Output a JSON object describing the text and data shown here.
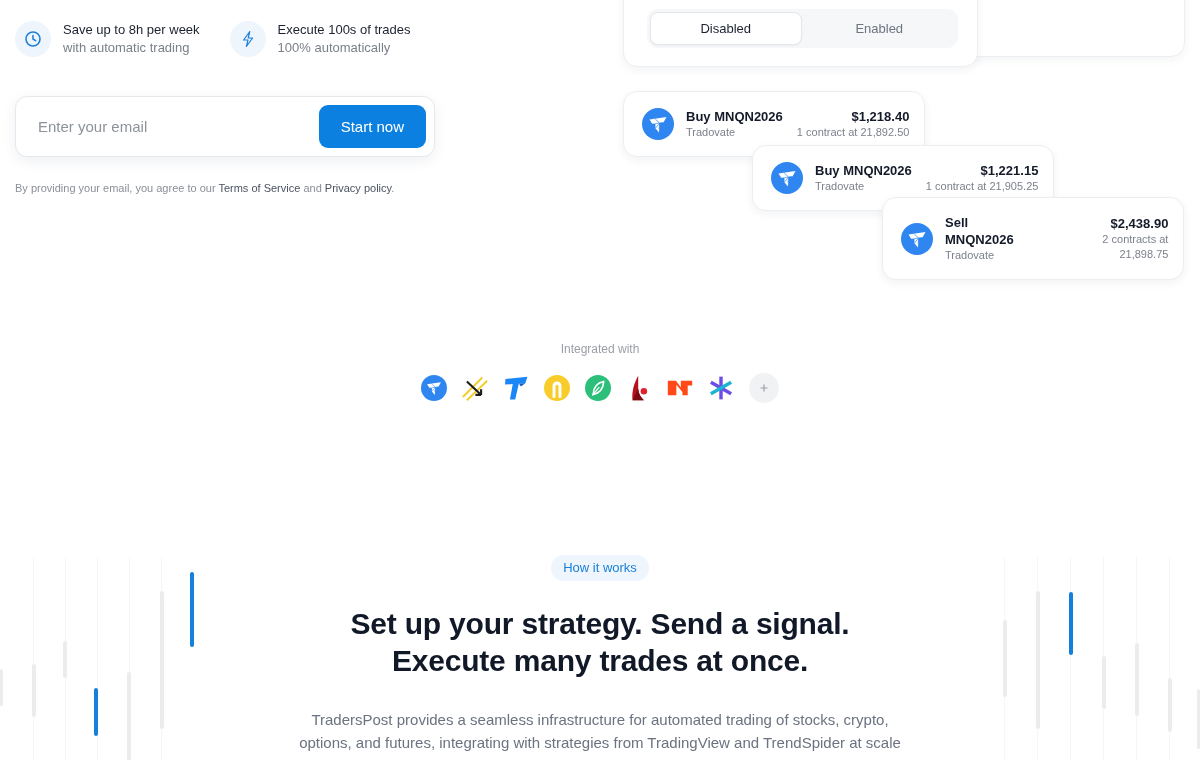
{
  "features": [
    {
      "title": "Save up to 8h per week",
      "subtitle": "with automatic trading"
    },
    {
      "title": "Execute 100s of trades",
      "subtitle": "100% automatically"
    }
  ],
  "signup_form": {
    "placeholder": "Enter your email",
    "button": "Start now"
  },
  "consent": {
    "text_before": "By providing your email, you agree to our",
    "terms_link": "Terms of Service",
    "text_between": "and",
    "privacy_link": "Privacy policy",
    "text_after": "."
  },
  "automation_toggle": {
    "options": [
      {
        "label": "Disabled",
        "selected": true
      },
      {
        "label": "Enabled",
        "selected": false
      }
    ]
  },
  "trades": [
    {
      "title": "Buy MNQN2026",
      "broker": "Tradovate",
      "amount": "$1,218.40",
      "detail": "1 contract at 21,892.50"
    },
    {
      "title": "Buy MNQN2026",
      "broker": "Tradovate",
      "amount": "$1,221.15",
      "detail": "1 contract at 21,905.25"
    },
    {
      "title": "Sell MNQN2026",
      "broker": "Tradovate",
      "amount": "$2,438.90",
      "detail": "2 contracts at 21,898.75"
    }
  ],
  "integrations": {
    "label": "Integrated with"
  },
  "how_it_works": {
    "badge": "How it works",
    "headline": "Set up your strategy. Send a signal. Execute many trades at once.",
    "description": "TradersPost provides a seamless infrastructure for automated trading of stocks, crypto, options, and futures, integrating with strategies from TradingView and TrendSpider at scale"
  }
}
